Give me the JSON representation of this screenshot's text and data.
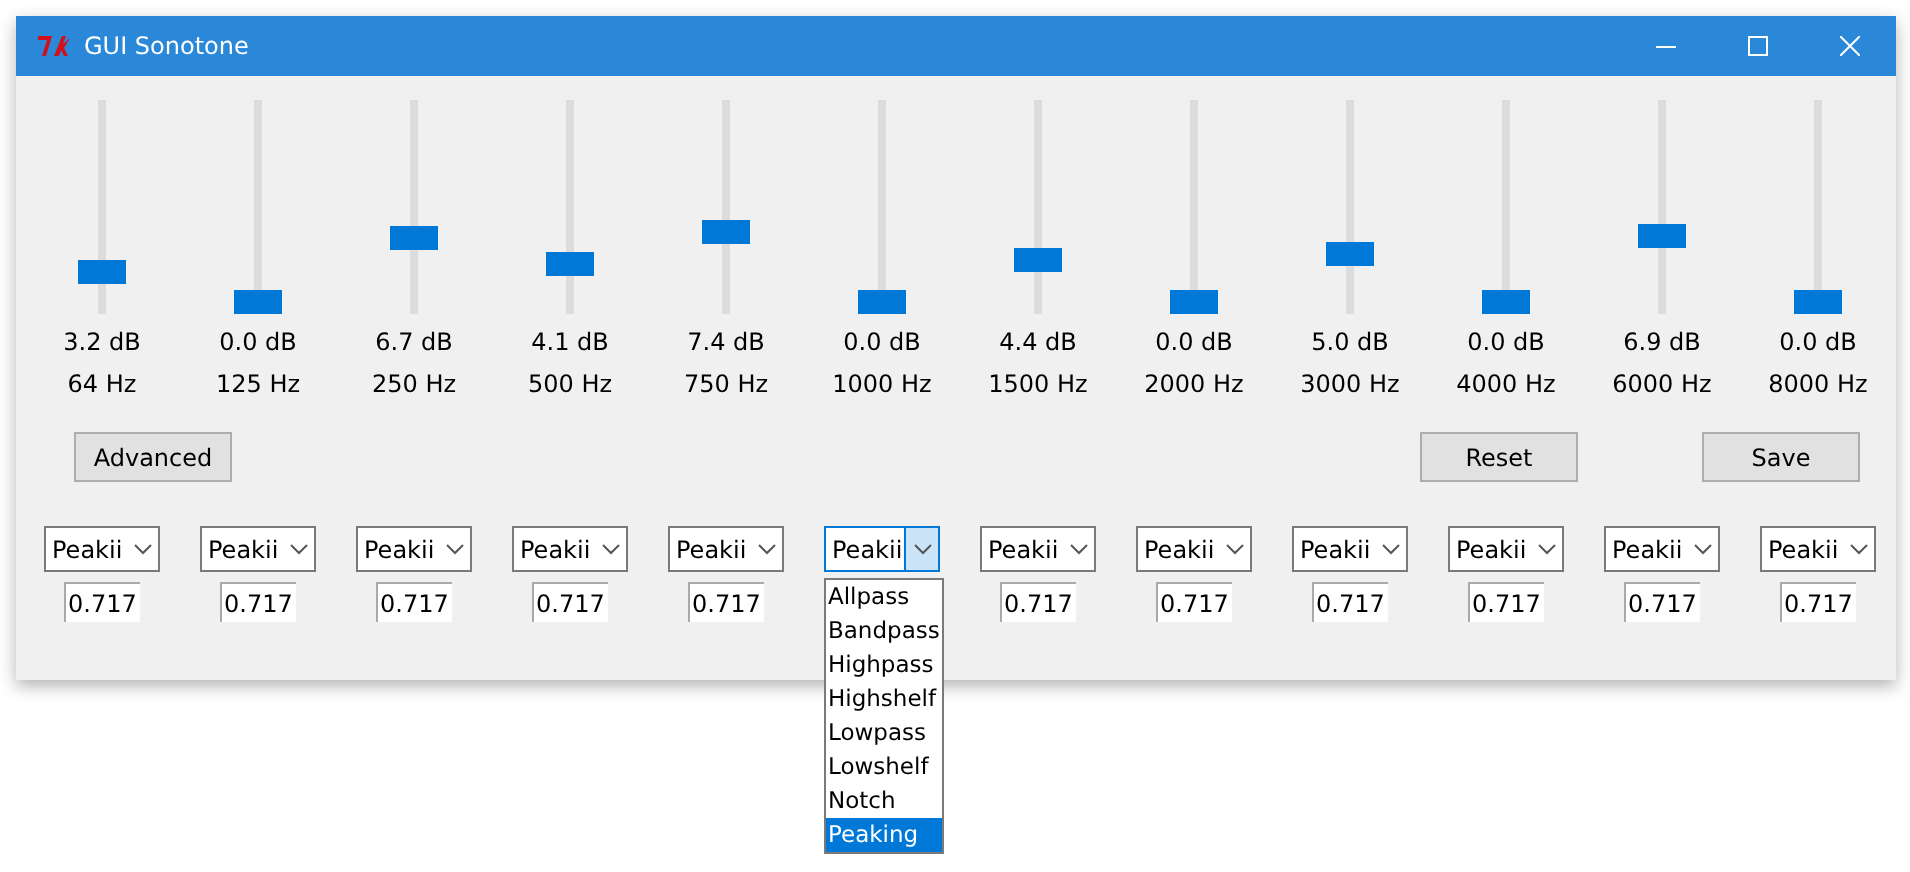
{
  "window": {
    "title": "GUI Sonotone"
  },
  "bands": [
    {
      "gain": "3.2 dB",
      "frequency": "64 Hz",
      "level": 0.16
    },
    {
      "gain": "0.0 dB",
      "frequency": "125 Hz",
      "level": 0
    },
    {
      "gain": "6.7 dB",
      "frequency": "250 Hz",
      "level": 0.335
    },
    {
      "gain": "4.1 dB",
      "frequency": "500 Hz",
      "level": 0.205
    },
    {
      "gain": "7.4 dB",
      "frequency": "750 Hz",
      "level": 0.37
    },
    {
      "gain": "0.0 dB",
      "frequency": "1000 Hz",
      "level": 0
    },
    {
      "gain": "4.4 dB",
      "frequency": "1500 Hz",
      "level": 0.22
    },
    {
      "gain": "0.0 dB",
      "frequency": "2000 Hz",
      "level": 0
    },
    {
      "gain": "5.0 dB",
      "frequency": "3000 Hz",
      "level": 0.25
    },
    {
      "gain": "0.0 dB",
      "frequency": "4000 Hz",
      "level": 0
    },
    {
      "gain": "6.9 dB",
      "frequency": "6000 Hz",
      "level": 0.345
    },
    {
      "gain": "0.0 dB",
      "frequency": "8000 Hz",
      "level": 0
    }
  ],
  "buttons": [
    {
      "label": "Advanced",
      "kind": "left"
    },
    {
      "label": "Reset",
      "kind": "right"
    },
    {
      "label": "Save",
      "kind": "right"
    }
  ],
  "filters": [
    {
      "type": "Peakii",
      "q": "0.717",
      "expanded": false
    },
    {
      "type": "Peakii",
      "q": "0.717",
      "expanded": false
    },
    {
      "type": "Peakii",
      "q": "0.717",
      "expanded": false
    },
    {
      "type": "Peakii",
      "q": "0.717",
      "expanded": false
    },
    {
      "type": "Peakii",
      "q": "0.717",
      "expanded": false
    },
    {
      "type": "Peakii",
      "expanded": true,
      "options": [
        {
          "label": "Allpass",
          "selected": false
        },
        {
          "label": "Bandpass",
          "selected": false
        },
        {
          "label": "Highpass",
          "selected": false
        },
        {
          "label": "Highshelf",
          "selected": false
        },
        {
          "label": "Lowpass",
          "selected": false
        },
        {
          "label": "Lowshelf",
          "selected": false
        },
        {
          "label": "Notch",
          "selected": false
        },
        {
          "label": "Peaking",
          "selected": true
        }
      ]
    },
    {
      "type": "Peakii",
      "q": "0.717",
      "expanded": false
    },
    {
      "type": "Peakii",
      "q": "0.717",
      "expanded": false
    },
    {
      "type": "Peakii",
      "q": "0.717",
      "expanded": false
    },
    {
      "type": "Peakii",
      "q": "0.717",
      "expanded": false
    },
    {
      "type": "Peakii",
      "q": "0.717",
      "expanded": false
    },
    {
      "type": "Peakii",
      "q": "0.717",
      "expanded": false
    }
  ]
}
